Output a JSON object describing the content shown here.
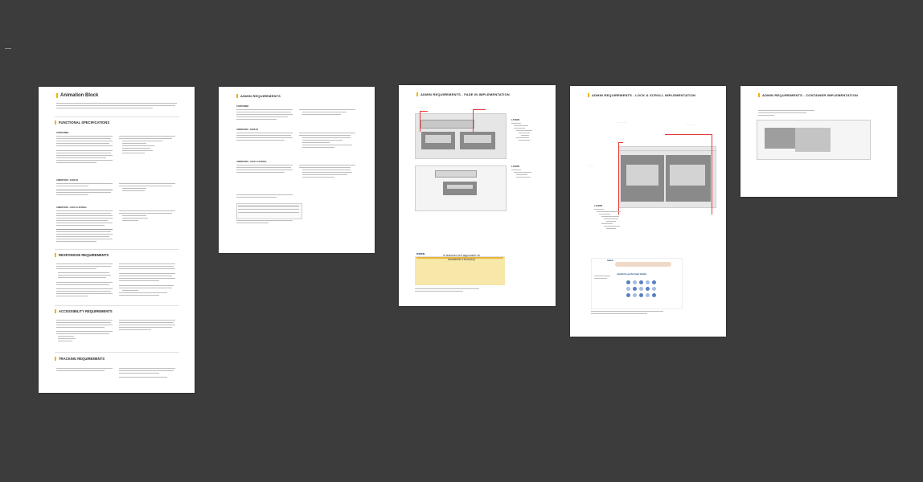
{
  "pages": {
    "p1": {
      "title": "Animation Block",
      "sections": {
        "functional": "FUNCTIONAL SPECIFICATIONS",
        "responsive": "RESPONSIVE REQUIREMENTS",
        "accessibility": "ACCESSIBILITY REQUIREMENTS",
        "tracking": "TRACKING REQUIREMENTS"
      },
      "subs": {
        "container": "CONTAINER",
        "fade_in": "ANIMATION - FADE IN",
        "lock_scroll": "ANIMATION - LOCK & SCROLL"
      }
    },
    "p2": {
      "title": "ADMIN REQUIREMENTS",
      "subs": {
        "container": "CONTAINER",
        "fade_in": "ANIMATION - FADE IN",
        "lock_scroll": "ANIMATION - LOCK & SCROLL"
      }
    },
    "p3": {
      "title": "ADMIN REQUIREMENTS - FADE IN IMPLEMENTATION",
      "layers_label": "LAYERS",
      "layers_label_2": "LAYERS",
      "preview_logo": "nwea",
      "preview_headline": "A teacher-led approach to academic recovery"
    },
    "p4": {
      "title": "ADMIN REQUIREMENTS - LOCK & SCROLL IMPLEMENTATION",
      "layers_label": "LAYERS",
      "preview_logo": "nwea",
      "preview_headline": "students performed better"
    },
    "p5": {
      "title": "ADMIN REQUIREMENTS - CONTAINER IMPLEMENTATION"
    }
  },
  "colors": {
    "canvas": "#3c3c3c",
    "accent": "#f4b400",
    "annotation": "#e53935",
    "preview_banner": "#f7e7a8"
  }
}
